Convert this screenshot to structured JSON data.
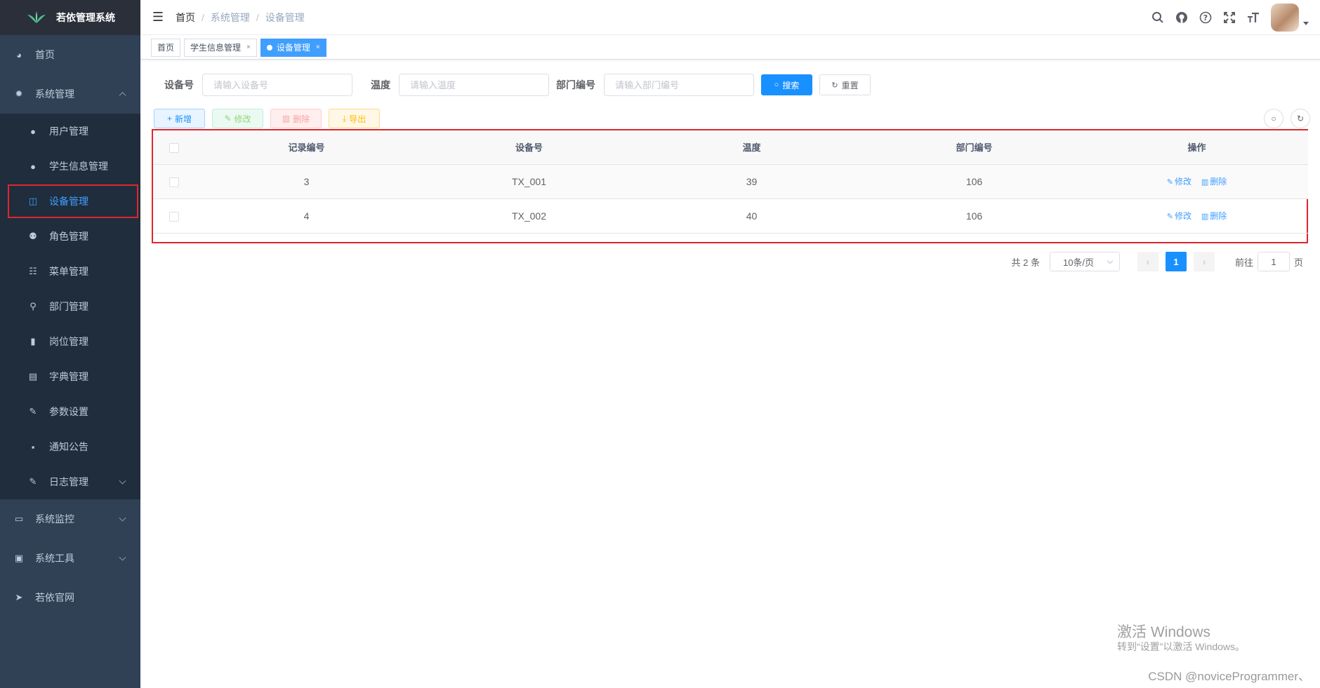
{
  "app": {
    "title": "若依管理系统"
  },
  "sidebar": {
    "items": [
      {
        "label": "首页",
        "icon": "dashboard-icon"
      },
      {
        "label": "系统管理",
        "icon": "gear-icon",
        "expanded": true,
        "children": [
          {
            "label": "用户管理",
            "icon": "user-icon"
          },
          {
            "label": "学生信息管理",
            "icon": "user-icon"
          },
          {
            "label": "设备管理",
            "icon": "table-icon",
            "active": true
          },
          {
            "label": "角色管理",
            "icon": "users-icon"
          },
          {
            "label": "菜单管理",
            "icon": "tree-list-icon"
          },
          {
            "label": "部门管理",
            "icon": "org-chart-icon"
          },
          {
            "label": "岗位管理",
            "icon": "badge-icon"
          },
          {
            "label": "字典管理",
            "icon": "dictionary-icon"
          },
          {
            "label": "参数设置",
            "icon": "edit-icon"
          },
          {
            "label": "通知公告",
            "icon": "message-icon"
          },
          {
            "label": "日志管理",
            "icon": "log-icon"
          }
        ]
      },
      {
        "label": "系统监控",
        "icon": "monitor-icon"
      },
      {
        "label": "系统工具",
        "icon": "toolbox-icon"
      },
      {
        "label": "若依官网",
        "icon": "send-icon"
      }
    ]
  },
  "header": {
    "breadcrumb": [
      "首页",
      "系统管理",
      "设备管理"
    ],
    "icons": [
      "search-icon",
      "github-icon",
      "question-icon",
      "fullscreen-icon",
      "font-size-icon"
    ]
  },
  "tags": [
    {
      "label": "首页"
    },
    {
      "label": "学生信息管理"
    },
    {
      "label": "设备管理",
      "active": true
    }
  ],
  "search": {
    "device_label": "设备号",
    "device_placeholder": "请输入设备号",
    "temp_label": "温度",
    "temp_placeholder": "请输入温度",
    "dept_label": "部门编号",
    "dept_placeholder": "请输入部门编号",
    "search_btn": "搜索",
    "reset_btn": "重置"
  },
  "toolbar": {
    "add": "新增",
    "edit": "修改",
    "delete": "删除",
    "export": "导出"
  },
  "table": {
    "columns": [
      "记录编号",
      "设备号",
      "温度",
      "部门编号",
      "操作"
    ],
    "rows": [
      {
        "id": "3",
        "device": "TX_001",
        "temp": "39",
        "dept": "106"
      },
      {
        "id": "4",
        "device": "TX_002",
        "temp": "40",
        "dept": "106"
      }
    ],
    "op_edit": "修改",
    "op_delete": "删除"
  },
  "pagination": {
    "total": "共 2 条",
    "page_size": "10条/页",
    "current": "1",
    "goto_prefix": "前往",
    "goto_value": "1",
    "goto_suffix": "页"
  },
  "watermark": {
    "line1": "激活 Windows",
    "line2": "转到“设置”以激活 Windows。",
    "csdn": "CSDN @noviceProgrammer、"
  },
  "colors": {
    "sidebar_bg": "#304156",
    "primary": "#1890ff",
    "highlight_border": "#e0262c"
  }
}
